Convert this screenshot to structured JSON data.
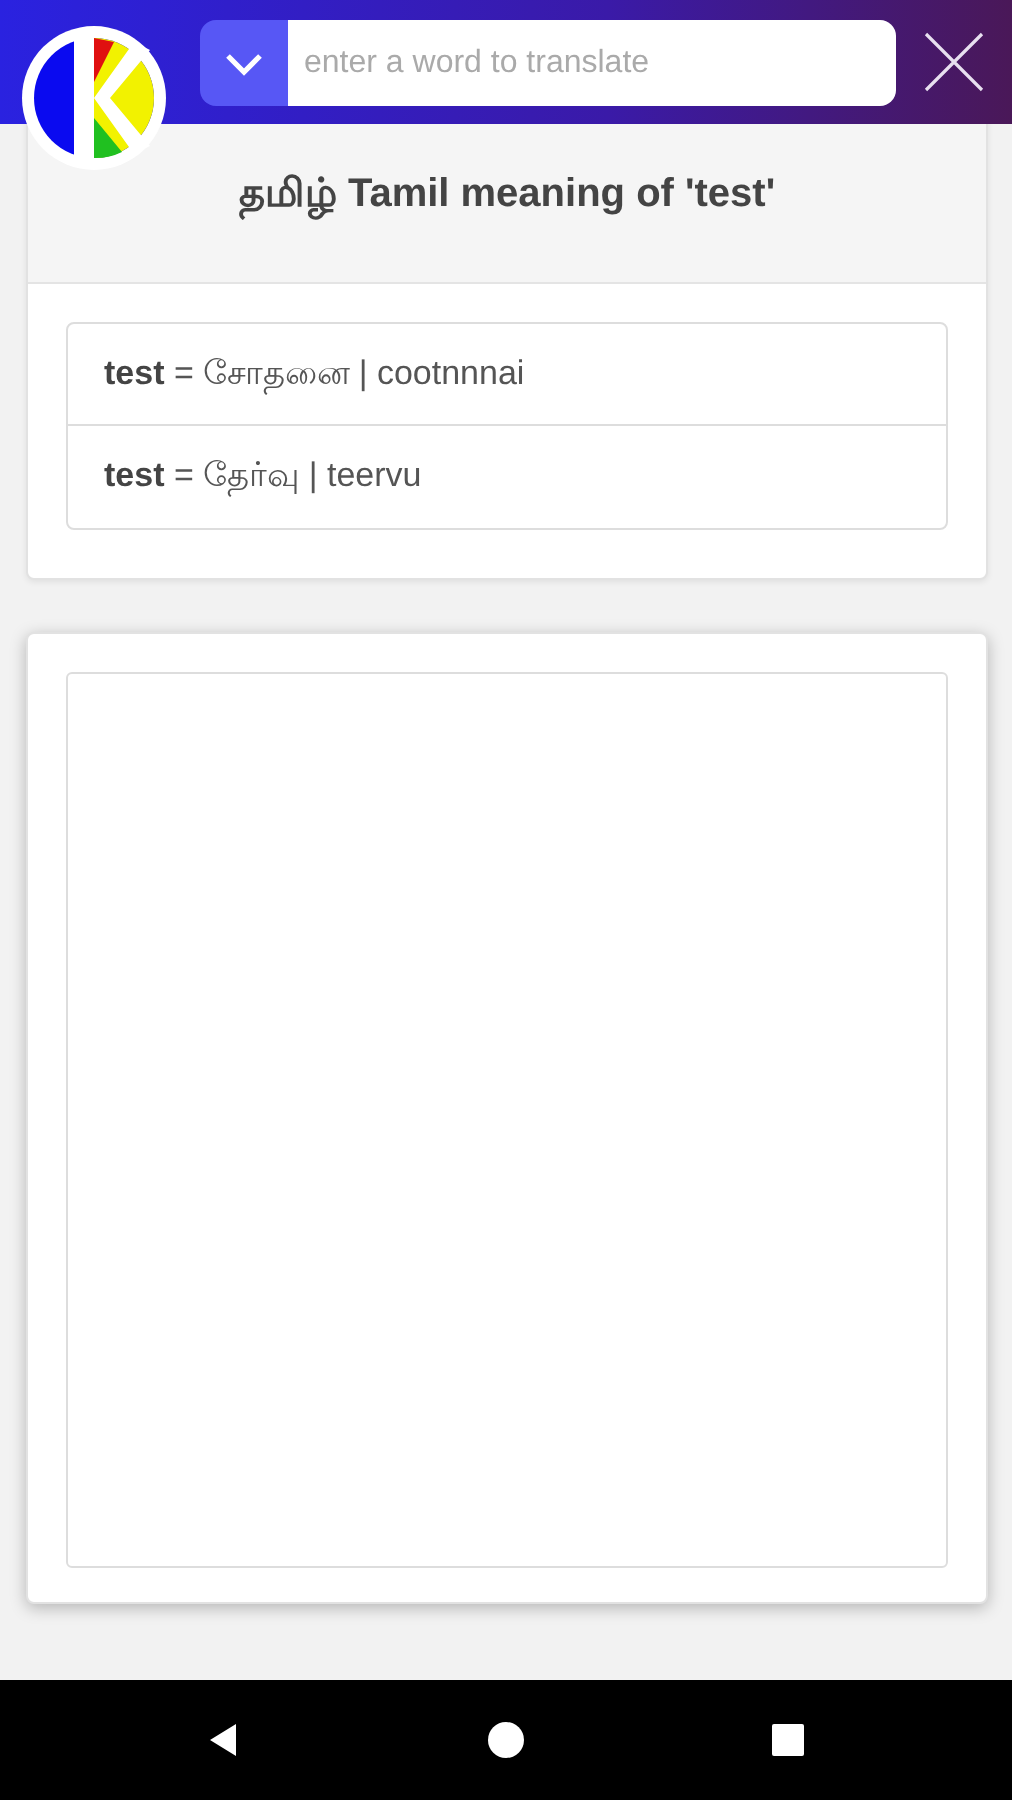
{
  "header": {
    "search": {
      "placeholder": "enter a word to translate"
    }
  },
  "meaning_card": {
    "title": "தமிழ் Tamil meaning of 'test'",
    "entries": [
      {
        "word": "test",
        "text": " = சோதனை | cootnnnai"
      },
      {
        "word": "test",
        "text": " = தேர்வு | teervu"
      }
    ]
  }
}
